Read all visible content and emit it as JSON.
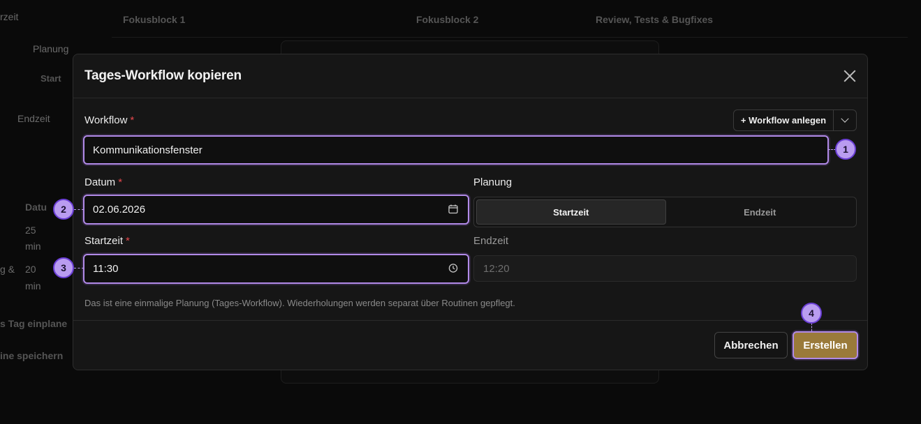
{
  "background": {
    "left_texts": [
      "rzeit",
      "Planung",
      "Start",
      "Endzeit",
      "Datu",
      "25",
      "min",
      "20",
      "min",
      "g &",
      "s Tag einplane",
      "ine speichern"
    ],
    "tabs": [
      {
        "title": "Fokusblock 1"
      },
      {
        "title": "Fokusblock 2"
      },
      {
        "title": "Review, Tests & Bugfixes"
      }
    ]
  },
  "modal": {
    "title": "Tages-Workflow kopieren",
    "workflow": {
      "label": "Workflow",
      "required_mark": "*",
      "value": "Kommunikationsfenster",
      "add_button": "+ Workflow anlegen"
    },
    "datum": {
      "label": "Datum",
      "required_mark": "*",
      "value": "02.06.2026"
    },
    "planung": {
      "label": "Planung",
      "options": [
        "Startzeit",
        "Endzeit"
      ],
      "selected": "Startzeit"
    },
    "startzeit": {
      "label": "Startzeit",
      "required_mark": "*",
      "value": "11:30"
    },
    "endzeit": {
      "label": "Endzeit",
      "value": "12:20"
    },
    "hint": "Das ist eine einmalige Planung (Tages-Workflow). Wiederholungen werden separat über Routinen gepflegt.",
    "footer": {
      "cancel_label": "Abbrechen",
      "create_label": "Erstellen"
    }
  },
  "markers": [
    "1",
    "2",
    "3",
    "4"
  ],
  "colors": {
    "focus_ring": "#b18ae8",
    "primary_button": "#9a7a3a",
    "required": "#e5484d",
    "marker": "#b99cf0"
  }
}
